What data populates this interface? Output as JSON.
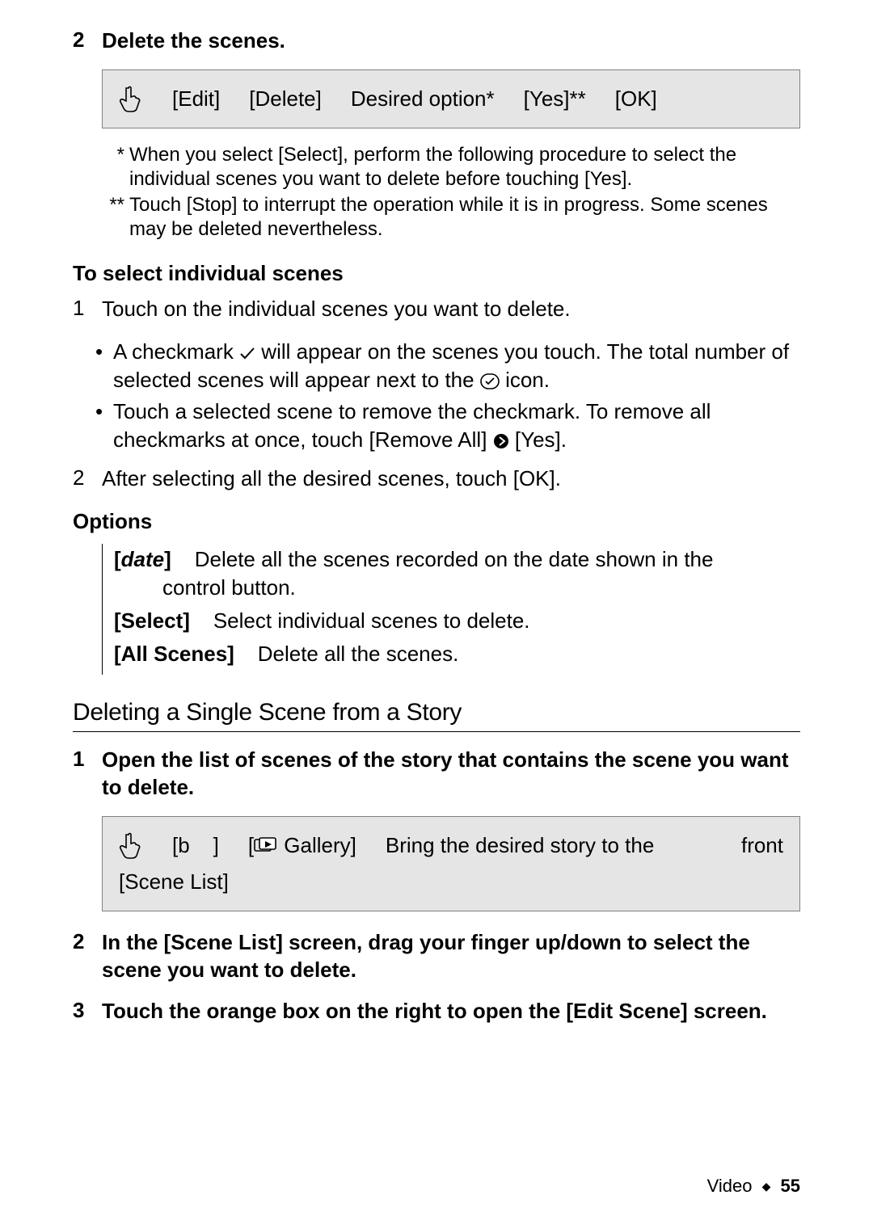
{
  "step2": {
    "num": "2",
    "title": "Delete the scenes."
  },
  "bar1": {
    "edit": "[Edit]",
    "delete": "[Delete]",
    "option": "Desired option*",
    "yes": "[Yes]**",
    "ok": "[OK]"
  },
  "footnotes": {
    "a_mark": "*",
    "a_text": "When you select [Select], perform the following procedure to select the individual scenes you want to delete before touching [Yes].",
    "b_mark": "**",
    "b_text": "Touch [Stop] to interrupt the operation while it is in progress. Some scenes may be deleted nevertheless."
  },
  "select_heading": "To select individual scenes",
  "sel_steps": {
    "s1_num": "1",
    "s1_text": "Touch on the individual scenes you want to delete.",
    "b1a_pre": "A checkmark ",
    "b1a_post": " will appear on the scenes you touch. The total number of selected scenes will appear next to the ",
    "b1a_tail": " icon.",
    "b1b_pre": "Touch a selected scene to remove the checkmark. To remove all checkmarks at once, touch [Remove All] ",
    "b1b_post": " [Yes].",
    "s2_num": "2",
    "s2_text": "After selecting all the desired scenes, touch [OK]."
  },
  "options_heading": "Options",
  "options": {
    "date_label_open": "[",
    "date_label_word": "date",
    "date_label_close": "]",
    "date_text_line1": "Delete all the scenes recorded on the date shown in the",
    "date_text_line2": "control button.",
    "select_label": "[Select]",
    "select_text": "Select individual scenes to delete.",
    "all_label": "[All Scenes]",
    "all_text": "Delete all the scenes."
  },
  "section2_title": "Deleting a Single Scene from a Story",
  "sec2": {
    "s1_num": "1",
    "s1_text": "Open the list of scenes of the story that contains the scene you want to delete.",
    "bar_b": "[b",
    "bar_b_close": "]",
    "bar_gallery_open": "[",
    "bar_gallery_word": " Gallery]",
    "bar_bring": "Bring the desired story to the",
    "bar_front": "front",
    "bar_scenelist": "[Scene List]",
    "s2_num": "2",
    "s2_text": "In the [Scene List] screen, drag your finger up/down to select the scene you want to delete.",
    "s3_num": "3",
    "s3_text": "Touch the orange box on the right to open the [Edit Scene] screen."
  },
  "footer": {
    "section": "Video",
    "page": "55"
  }
}
